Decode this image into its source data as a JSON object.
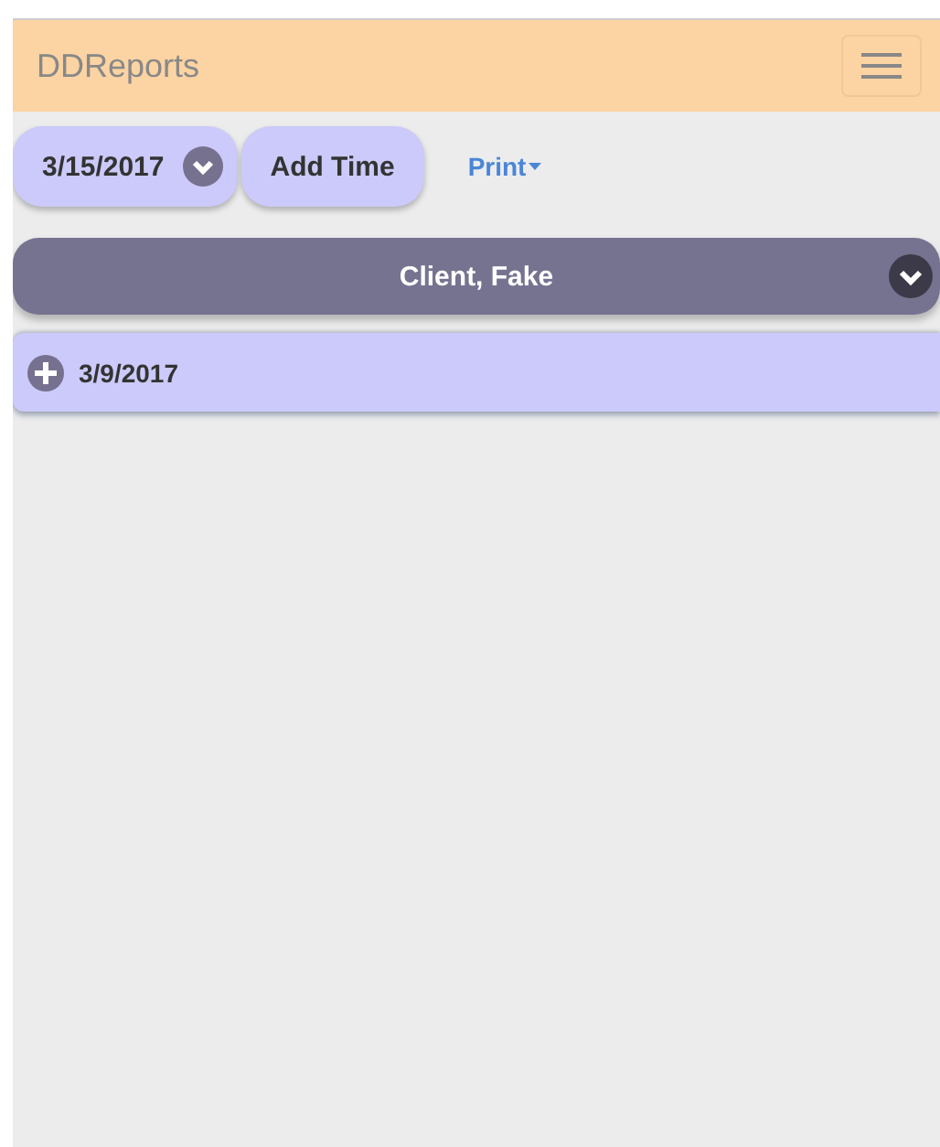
{
  "navbar": {
    "brand": "DDReports"
  },
  "toolbar": {
    "date": "3/15/2017",
    "add_button": "Add Time",
    "print_menu": "Print"
  },
  "client": {
    "name": "Client, Fake",
    "expanded": true,
    "entries": [
      {
        "date": "3/9/2017",
        "expanded": false
      }
    ]
  }
}
